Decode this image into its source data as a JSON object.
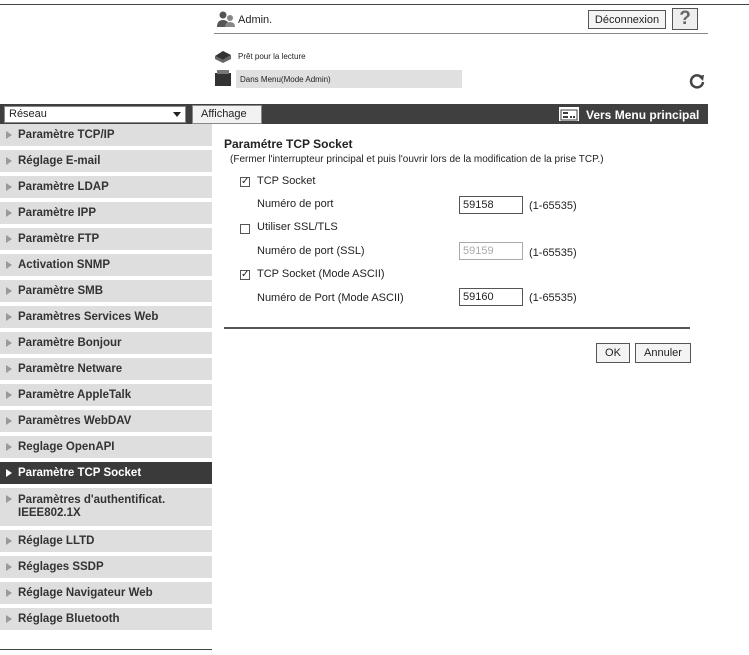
{
  "header": {
    "user_label": "Admin.",
    "logout_label": "Déconnexion",
    "help_label": "?",
    "status_text": "Prêt pour la lecture",
    "mode_text": "Dans Menu(Mode Admin)"
  },
  "toolbar": {
    "category_select": "Réseau",
    "view_tab": "Affichage",
    "main_menu_label": "Vers Menu principal"
  },
  "sidebar": {
    "items": [
      {
        "label": "Paramètre TCP/IP"
      },
      {
        "label": "Réglage E-mail"
      },
      {
        "label": "Paramètre LDAP"
      },
      {
        "label": "Paramètre IPP"
      },
      {
        "label": "Paramètre FTP"
      },
      {
        "label": "Activation SNMP"
      },
      {
        "label": "Paramètre SMB"
      },
      {
        "label": "Paramètres Services Web"
      },
      {
        "label": "Paramètre Bonjour"
      },
      {
        "label": "Paramètre Netware"
      },
      {
        "label": "Paramètre AppleTalk"
      },
      {
        "label": "Paramètres WebDAV"
      },
      {
        "label": "Reglage OpenAPI"
      },
      {
        "label": "Paramètre TCP Socket"
      },
      {
        "label": "Paramètres d'authentificat. IEEE802.1X"
      },
      {
        "label": "Réglage LLTD"
      },
      {
        "label": "Réglages SSDP"
      },
      {
        "label": "Réglage Navigateur Web"
      },
      {
        "label": "Réglage Bluetooth"
      }
    ],
    "active_index": 13
  },
  "main": {
    "title": "Paramétre TCP Socket",
    "note": "(Fermer l'interrupteur principal et puis l'ouvrir lors de la modification de la prise TCP.)",
    "tcp_socket": {
      "label": "TCP Socket",
      "checked": true
    },
    "port": {
      "label": "Numéro de port",
      "value": "59158",
      "range": "(1-65535)"
    },
    "ssl": {
      "label": "Utiliser SSL/TLS",
      "checked": false
    },
    "ssl_port": {
      "label": "Numéro de port (SSL)",
      "value": "59159",
      "range": "(1-65535)"
    },
    "ascii": {
      "label": "TCP Socket (Mode ASCII)",
      "checked": true
    },
    "ascii_port": {
      "label": "Numéro de Port (Mode ASCII)",
      "value": "59160",
      "range": "(1-65535)"
    },
    "ok_label": "OK",
    "cancel_label": "Annuler"
  },
  "colors": {
    "topbar_bg": "#3f3f3f",
    "sidebar_bg": "#dedede",
    "sidebar_active_bg": "#3a3a3a"
  }
}
